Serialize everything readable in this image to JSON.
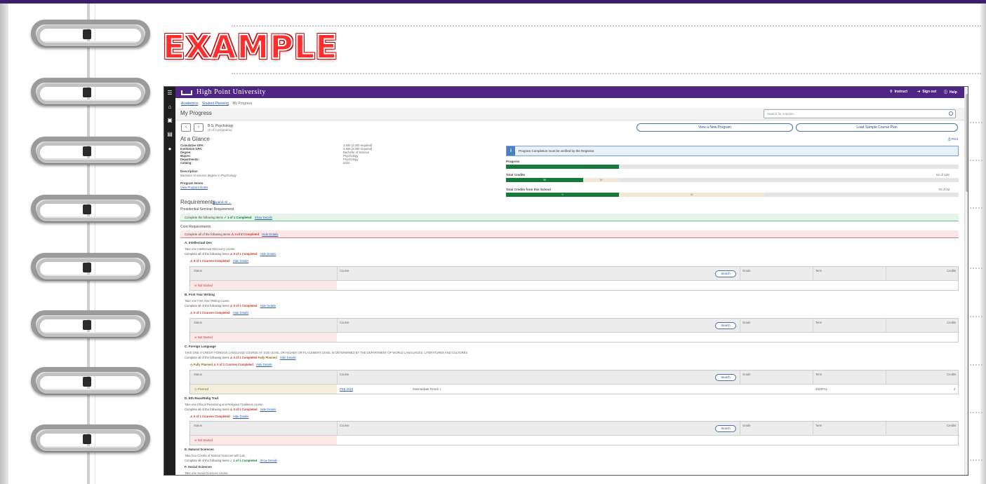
{
  "watermark": {
    "text": "EXAMPLE"
  },
  "app": {
    "header": {
      "logo_text": "High Point University",
      "instruct": "Instruct",
      "sign_out": "Sign out",
      "help": "Help"
    },
    "breadcrumb": [
      "Academics",
      "Student Planning",
      "My Progress"
    ],
    "page_title": "My Progress",
    "search_placeholder": "Search for courses...",
    "program": {
      "name": "B.S. Psychology",
      "count": "(2 of 2 programs)"
    },
    "buttons": {
      "view_new_program": "View a New Program",
      "load_sample": "Load Sample Course Plan"
    },
    "at_a_glance": {
      "title": "At a Glance",
      "print": "Print",
      "labels": [
        "Cumulative GPA:",
        "Institution GPA:",
        "Degree:",
        "Majors:",
        "Departments:",
        "Catalog:"
      ],
      "values": [
        "3.500 (2.000 required)",
        "3.500 (2.000 required)",
        "Bachelor of Science",
        "Psychology",
        "Psychology",
        "2022"
      ],
      "description_label": "Description",
      "description": "Bachelor of science degree in Psychology",
      "notes_label": "Program Notes",
      "notes_link": "View Program Notes"
    },
    "info_banner": "Program Completion must be verified by the Registrar.",
    "progress": {
      "progress_label": "Progress",
      "progress_fraction": 0.25,
      "total_credits_label": "Total Credits",
      "total_credits_count": "52 of 128",
      "total_credits_done": "36",
      "total_credits_planned": "16",
      "total_credits_done_fraction": 0.17,
      "total_credits_planned_fraction": 0.08,
      "school_credits_label": "Total Credits from this School",
      "school_credits_count": "76 of 32",
      "school_credits_done": "0",
      "school_credits_planned": "16",
      "school_credits_done_fraction": 0.25,
      "school_credits_planned_fraction": 0.32
    },
    "requirements": {
      "title": "Requirements",
      "expand_all": "Expand All",
      "presidential": {
        "title": "Presidential Seminar Requirement",
        "prefix": "Complete the following items",
        "status": "1 of 1 Completed",
        "link": "Show Details"
      },
      "core": {
        "title": "Core Requirements",
        "prefix": "Complete all of the following items",
        "status": "0 of 8 Completed",
        "link": "Hide Details"
      },
      "sections": [
        {
          "title": "A. Intellectual Dev",
          "desc": "Take one Intellectual Discovery course.",
          "line_prefix": "Complete all of the following items",
          "line_status": "0 of 1 Completed",
          "line_link": "Hide Details",
          "sub_status": "0 of 1 Courses Completed",
          "sub_link": "Hide Details",
          "row_status": "Not Started"
        },
        {
          "title": "B. First Year Writing",
          "desc": "Take one First Year Writing course.",
          "line_prefix": "Complete all of the following items",
          "line_status": "0 of 1 Completed",
          "line_link": "Hide Details",
          "sub_status": "0 of 1 Courses Completed",
          "sub_link": "Hide Details",
          "row_status": "Not Started"
        },
        {
          "title": "C. Foreign Language",
          "desc": "TAKE ONE 4-CREDIT FOREIGN LANGUAGE COURSE AT 1020 LEVEL OR HIGHER OR PLACEMENT LEVEL IS DETERMINED BY THE DEPARTMENT OF WORLD LANGUAGES, LITERATURES AND CULTURES",
          "line_prefix": "Complete all of the following items",
          "line_status": "0 of 1 Completed",
          "line_planned": "Fully Planned",
          "line_link": "Hide Details",
          "sub_planned": "Fully Planned",
          "sub_status": "0 of 1 Courses Completed",
          "sub_link": "Hide Details",
          "row_status": "Planned",
          "row_course": "FRE-2010",
          "row_title": "Intermediate French I",
          "row_term": "2023FA1",
          "row_credits": "4"
        },
        {
          "title": "D. Eth Reas/Relig Trad",
          "desc": "Take one Ethical Reasoning and Religious Traditions course.",
          "line_prefix": "Complete all of the following items",
          "line_status": "0 of 1 Completed",
          "line_link": "Hide Details",
          "sub_status": "0 of 1 Courses Completed",
          "sub_link": "Hide Details",
          "row_status": "Not Started"
        }
      ],
      "natural": {
        "title": "E. Natural Sciences",
        "desc": "Take four Credits of Natural Sciences with Lab.",
        "line_prefix": "Complete all of the following items",
        "line_status": "1 of 1 Completed",
        "line_link": "Show Details"
      },
      "social": {
        "title": "F. Social Sciences",
        "desc": "Take one Social Sciences course."
      }
    },
    "table": {
      "status": "Status",
      "course": "Course",
      "search": "Search",
      "grade": "Grade",
      "term": "Term",
      "credits": "Credits"
    }
  }
}
